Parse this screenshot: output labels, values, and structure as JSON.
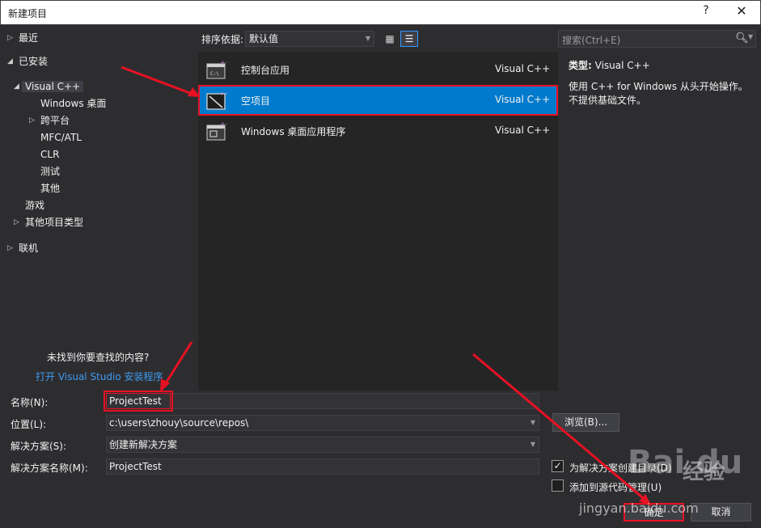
{
  "window": {
    "title": "新建项目",
    "help_glyph": "?",
    "close_glyph": "✕"
  },
  "left_panel": {
    "recent": "最近",
    "installed": "已安装",
    "visual_cpp": "Visual C++",
    "windows_desktop": "Windows 桌面",
    "cross_platform": "跨平台",
    "mfc_atl": "MFC/ATL",
    "clr": "CLR",
    "test": "测试",
    "other": "其他",
    "games": "游戏",
    "other_project_types": "其他项目类型",
    "online": "联机",
    "not_found": "未找到你要查找的内容?",
    "installer_link": "打开 Visual Studio 安装程序"
  },
  "sort": {
    "label": "排序依据:",
    "value": "默认值"
  },
  "templates": [
    {
      "name": "控制台应用",
      "lang": "Visual C++",
      "icon": "console-app-icon"
    },
    {
      "name": "空项目",
      "lang": "Visual C++",
      "icon": "empty-project-icon"
    },
    {
      "name": "Windows 桌面应用程序",
      "lang": "Visual C++",
      "icon": "windows-desktop-app-icon"
    }
  ],
  "search": {
    "placeholder": "搜索(Ctrl+E)"
  },
  "description": {
    "type_label": "类型:",
    "type_value": "Visual C++",
    "text": "使用 C++ for Windows 从头开始操作。不提供基础文件。"
  },
  "form": {
    "name_label": "名称(N):",
    "name_value": "ProjectTest",
    "location_label": "位置(L):",
    "location_value": "c:\\users\\zhouy\\source\\repos\\",
    "solution_label": "解决方案(S):",
    "solution_value": "创建新解决方案",
    "solution_name_label": "解决方案名称(M):",
    "solution_name_value": "ProjectTest",
    "browse_label": "浏览(B)...",
    "create_dir_label": "为解决方案创建目录(D)",
    "create_dir_checked": true,
    "source_control_label": "添加到源代码管理(U)",
    "source_control_checked": false,
    "ok_label": "确定",
    "cancel_label": "取消"
  },
  "watermark": {
    "logo": "Bai du",
    "brand": "经验",
    "url": "jingyan.baidu.com"
  },
  "colors": {
    "accent": "#007acc",
    "highlight": "#e81123",
    "link": "#3e9cf0",
    "background": "#2d2d30"
  }
}
